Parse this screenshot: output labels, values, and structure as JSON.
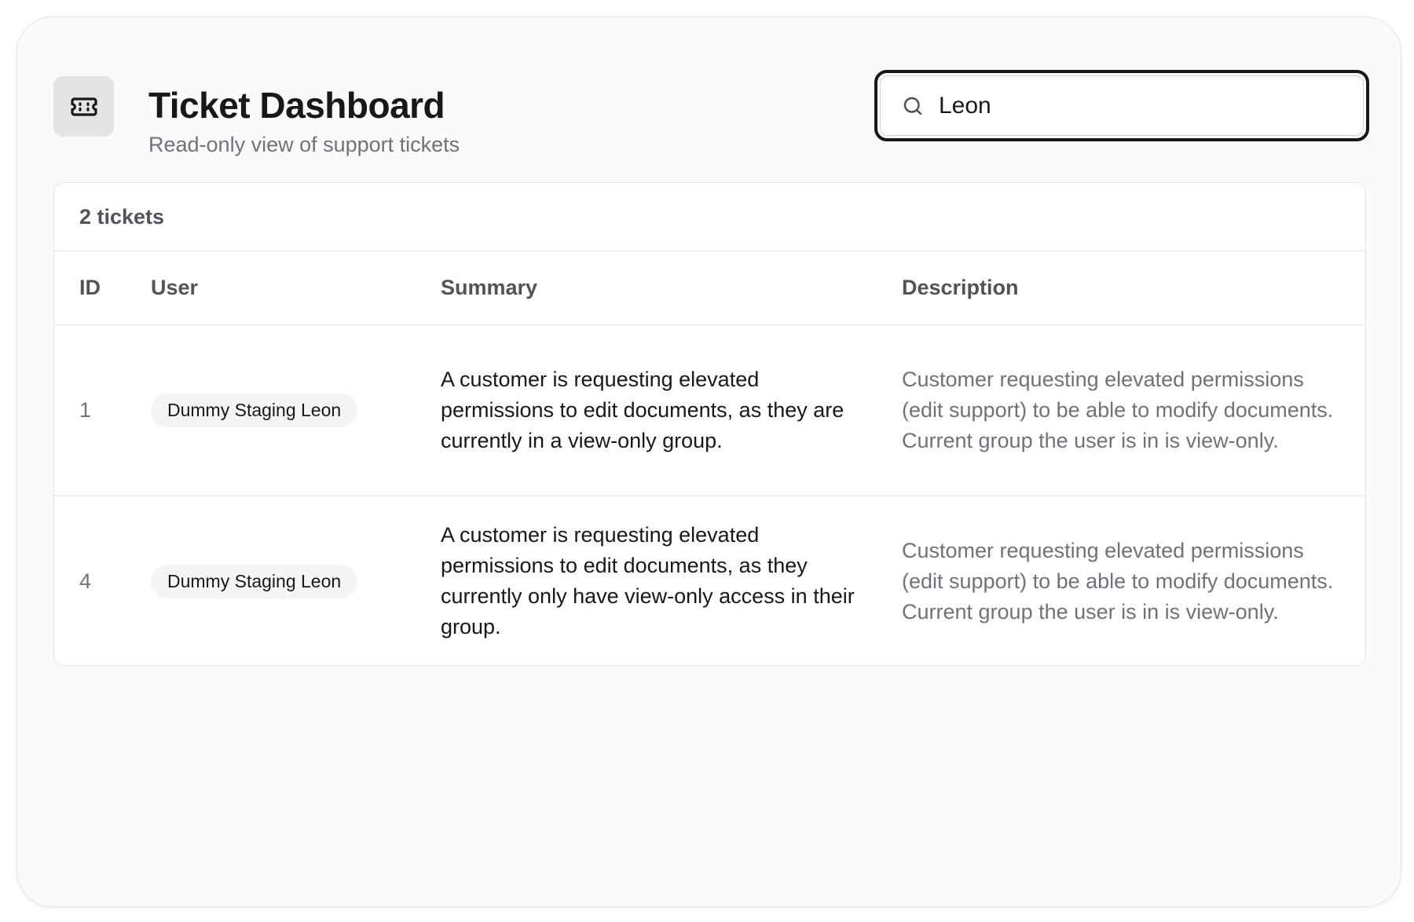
{
  "header": {
    "title": "Ticket Dashboard",
    "subtitle": "Read-only view of support tickets",
    "logo_icon": "ticket-icon"
  },
  "search": {
    "icon": "search-icon",
    "value": "Leon",
    "placeholder": ""
  },
  "table": {
    "count_label": "2 tickets",
    "columns": [
      "ID",
      "User",
      "Summary",
      "Description"
    ],
    "rows": [
      {
        "id": "1",
        "user": "Dummy Staging Leon",
        "summary": "A customer is requesting elevated permissions to edit documents, as they are currently in a view-only group.",
        "description": "Customer requesting elevated permissions (edit support) to be able to modify documents. Current group the user is in is view-only."
      },
      {
        "id": "4",
        "user": "Dummy Staging Leon",
        "summary": "A customer is requesting elevated permissions to edit documents, as they currently only have view-only access in their group.",
        "description": "Customer requesting elevated permissions (edit support) to be able to modify documents. Current group the user is in is view-only."
      }
    ]
  },
  "colors": {
    "frame_bg": "#fafafa",
    "text_primary": "#18181b",
    "text_muted": "#71717a",
    "border": "#e4e4e7",
    "badge_bg": "#f4f4f5"
  }
}
